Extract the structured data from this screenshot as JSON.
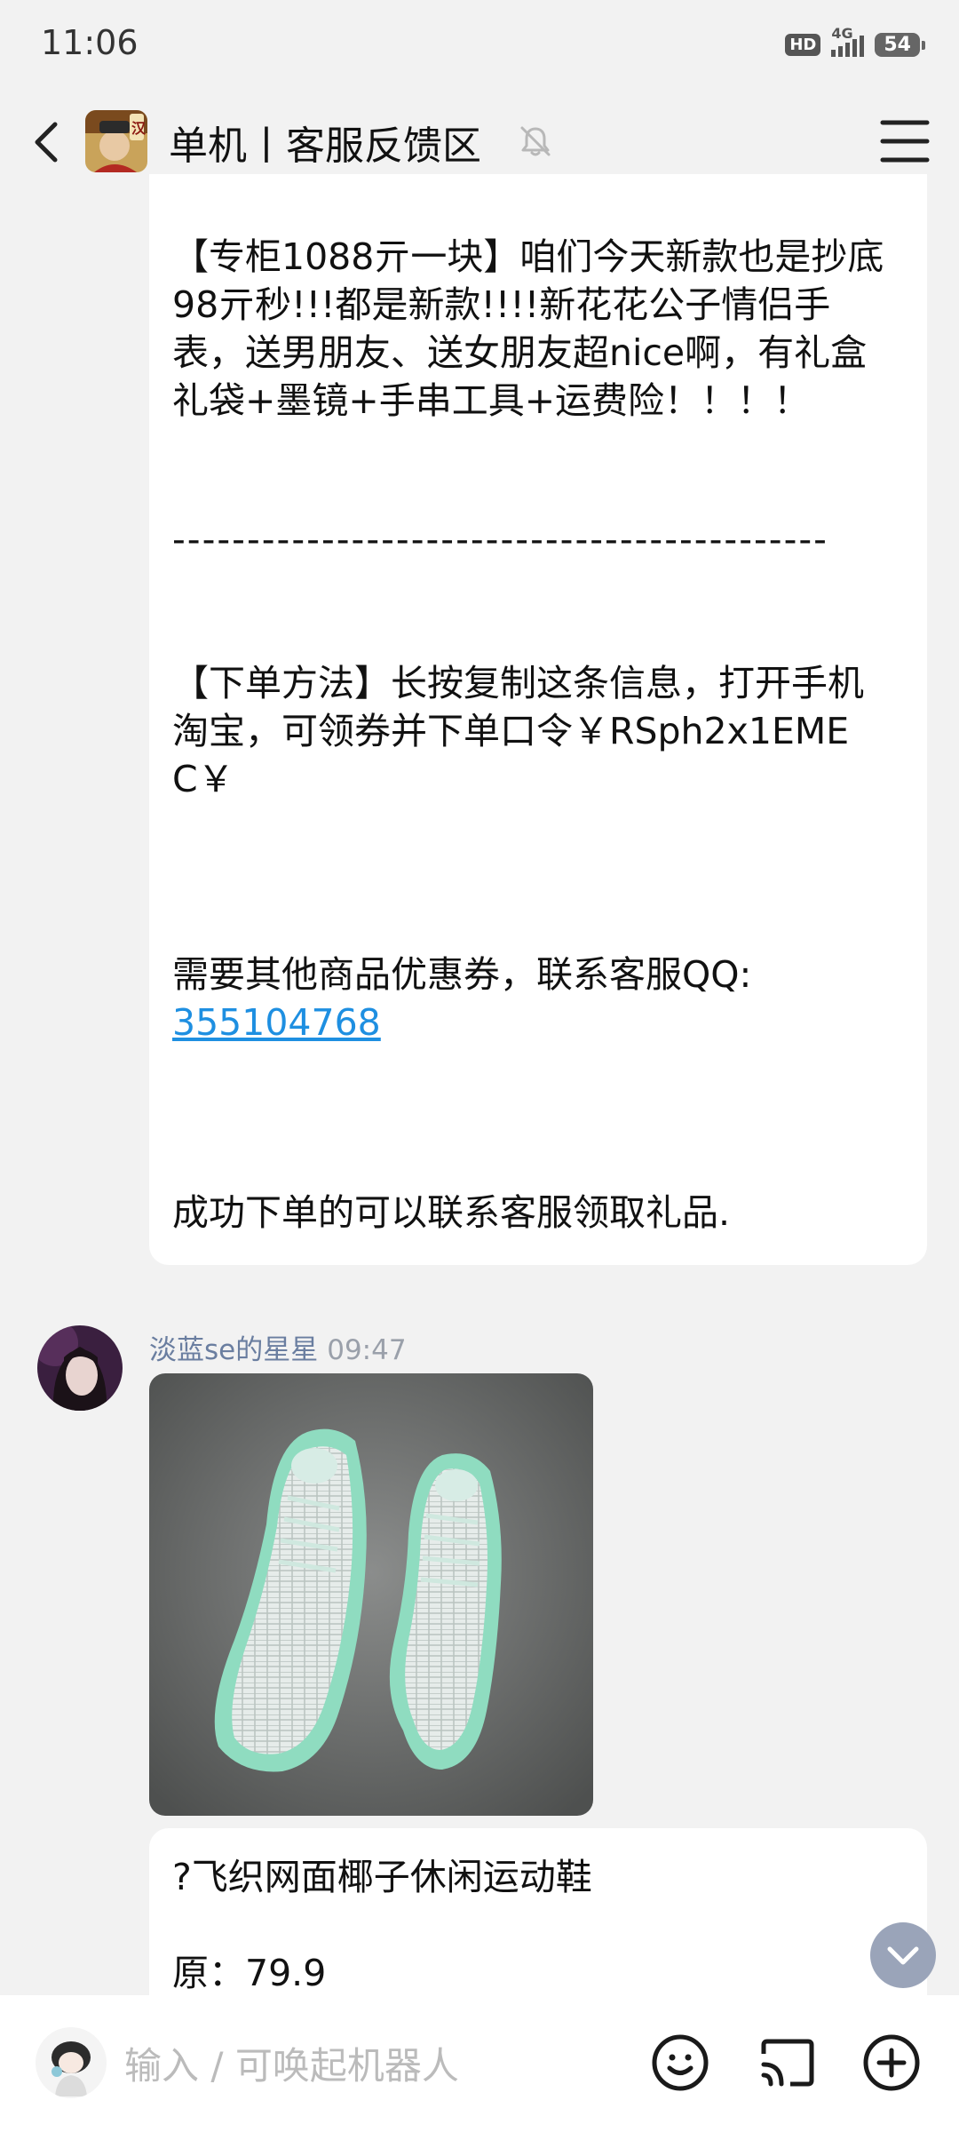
{
  "status_bar": {
    "time": "11:06",
    "hd": "HD",
    "network": "4G",
    "battery": "54"
  },
  "header": {
    "title": "单机丨客服反馈区"
  },
  "messages": {
    "promo": {
      "line1": "【专柜1088亓一块】咱们今天新款也是抄底98亓秒!!!都是新款!!!!新花花公子情侣手表，送男朋友、送女朋友超nice啊，有礼盒礼袋+墨镜+手串工具+运费险！！！！",
      "divider": "--------------------------------------------",
      "line2": "【下单方法】长按复制这条信息，打开手机淘宝，可领券并下单口令￥RSph2x1EMEC￥",
      "line3": "需要其他商品优惠券，联系客服QQ:",
      "qq": "355104768",
      "line4": "成功下单的可以联系客服领取礼品."
    },
    "shoe": {
      "sender": "淡蓝se的星星",
      "time": "09:47",
      "title": "?飞织网面椰子休闲运动鞋",
      "price": "原：79.9"
    }
  },
  "input": {
    "placeholder": "输入 / 可唤起机器人"
  }
}
